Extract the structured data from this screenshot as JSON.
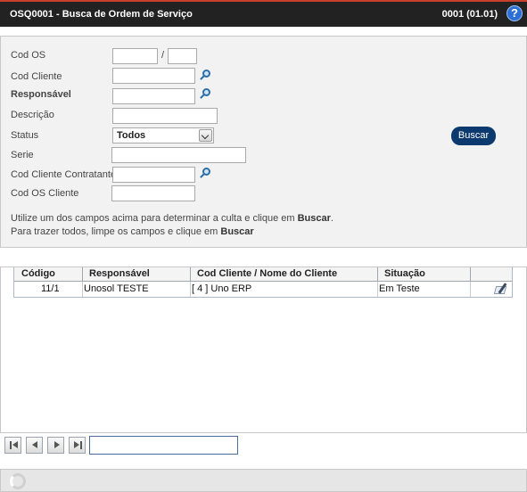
{
  "titlebar": {
    "title": "OSQ0001 - Busca de Ordem de Serviço",
    "version": "0001 (01.01)",
    "help_glyph": "?"
  },
  "form": {
    "cod_os": {
      "label": "Cod OS",
      "value1": "",
      "value2": "",
      "separator": "/"
    },
    "cod_cliente": {
      "label": "Cod Cliente",
      "value": ""
    },
    "responsavel": {
      "label": "Responsável",
      "value": ""
    },
    "descricao": {
      "label": "Descrição",
      "value": ""
    },
    "status": {
      "label": "Status",
      "selected": "Todos"
    },
    "serie": {
      "label": "Serie",
      "value": ""
    },
    "cod_cliente_contratante": {
      "label": "Cod Cliente Contratante",
      "value": ""
    },
    "cod_os_cliente": {
      "label": "Cod OS Cliente",
      "value": ""
    },
    "buscar_label": "Buscar",
    "hint_line1_prefix": "Utilize um dos campos acima para determinar a",
    "hint_line1_mid": "c",
    "hint_line1_suffix": "ulta e clique em",
    "hint_line1_bold": "Buscar",
    "hint_line1_end": ".",
    "hint_line2_prefix": "Para trazer todos, limpe os campos e clique em",
    "hint_line2_bold": "Buscar"
  },
  "grid": {
    "columns": [
      "Código",
      "Responsável",
      "Cod Cliente / Nome do Cliente",
      "Situação"
    ],
    "rows": [
      {
        "codigo": "11/1",
        "responsavel": "Unosol TESTE",
        "cliente": "[ 4 ] Uno ERP",
        "situacao": "Em Teste"
      }
    ]
  },
  "pager": {
    "page_value": ""
  },
  "icons": {
    "help": "help-icon",
    "lookup": "magnifier-icon",
    "edit": "edit-icon",
    "first": "first-page-icon",
    "prev": "previous-page-icon",
    "next": "next-page-icon",
    "last": "last-page-icon",
    "loading": "loading-spinner-icon"
  },
  "colors": {
    "titlebar_bg": "#222222",
    "titlebar_accent": "#c8402c",
    "button_bg": "#0d3a6e",
    "help_bg": "#2e6fd6"
  }
}
